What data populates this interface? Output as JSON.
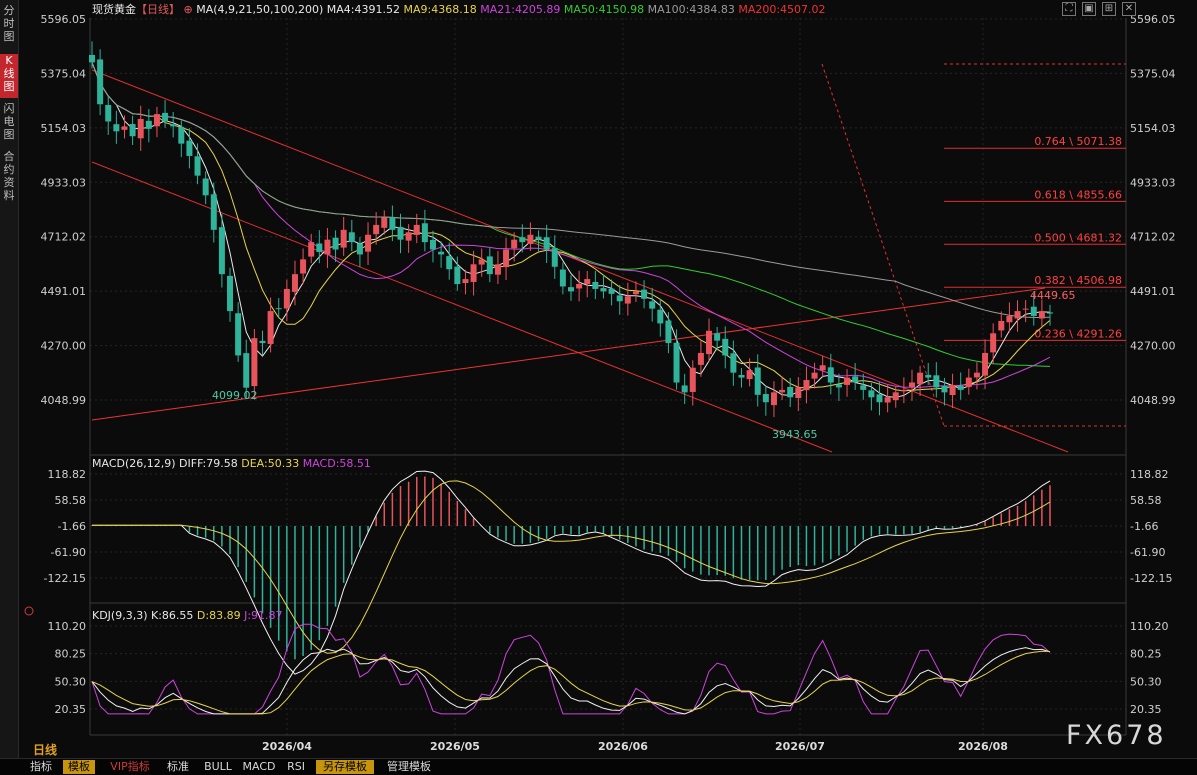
{
  "sidebar": {
    "tabs": [
      {
        "label": "分时图",
        "active": false
      },
      {
        "label": "K线图",
        "active": true
      },
      {
        "label": "闪电图",
        "active": false
      },
      {
        "label": "合约资料",
        "active": false
      }
    ]
  },
  "header": {
    "title": "现货黄金",
    "timeframe": "【日线】",
    "ma_label": "MA(4,9,21,50,100,200)",
    "ma_values": [
      {
        "text": "MA4:4391.52",
        "color": "#e8e8e8"
      },
      {
        "text": "MA9:4368.18",
        "color": "#e8d44a"
      },
      {
        "text": "MA21:4205.89",
        "color": "#cc44dd"
      },
      {
        "text": "MA50:4150.98",
        "color": "#33cc33"
      },
      {
        "text": "MA100:4384.83",
        "color": "#9a9a9a"
      },
      {
        "text": "MA200:4507.02",
        "color": "#ee3333"
      }
    ]
  },
  "price_axis": [
    "5596.05",
    "5375.04",
    "5154.03",
    "4933.03",
    "4712.02",
    "4491.01",
    "4270.00",
    "4048.99"
  ],
  "macd": {
    "label": "MACD(26,12,9)",
    "diff": "DIFF:79.58",
    "dea": "DEA:50.33",
    "macd": "MACD:58.51",
    "axis": [
      "118.82",
      "58.58",
      "-1.66",
      "-61.90",
      "-122.15"
    ]
  },
  "kdj": {
    "label": "KDJ(9,3,3)",
    "k": "K:86.55",
    "d": "D:83.89",
    "j": "J:91.87",
    "axis": [
      "110.20",
      "80.25",
      "50.30",
      "20.35"
    ]
  },
  "x_axis": [
    "2026/04",
    "2026/05",
    "2026/06",
    "2026/07",
    "2026/08"
  ],
  "fib_levels": [
    "0.764 \\ 5071.38",
    "0.618 \\ 4855.66",
    "0.500 \\ 4681.32",
    "0.382 \\ 4506.98",
    "0.236 \\ 4291.26"
  ],
  "price_labels": {
    "low1": "4099.02",
    "low2": "3943.65",
    "high": "4449.65"
  },
  "timeframe_label": "日线",
  "toolbar": [
    "指标",
    "模板",
    "VIP指标",
    "标准",
    "BULL",
    "MACD",
    "RSI",
    "另存模板",
    "管理模板"
  ],
  "watermark": "FX678",
  "colors": {
    "up": "#e8545c",
    "down": "#2fb39a",
    "grid": "#2a2a2a",
    "accent": "#e23a3a"
  },
  "chart_data": {
    "type": "candlestick",
    "title": "现货黄金 【日线】",
    "x_labels": [
      "2026/04",
      "2026/05",
      "2026/06",
      "2026/07",
      "2026/08"
    ],
    "ylim": [
      3943.65,
      5596.05
    ],
    "close_series": [
      5420,
      5250,
      5180,
      5140,
      5160,
      5120,
      5190,
      5150,
      5210,
      5180,
      5160,
      5090,
      5040,
      4960,
      4880,
      4740,
      4560,
      4410,
      4230,
      4099,
      4300,
      4280,
      4410,
      4420,
      4500,
      4560,
      4620,
      4690,
      4650,
      4700,
      4660,
      4740,
      4690,
      4640,
      4720,
      4760,
      4790,
      4740,
      4700,
      4730,
      4760,
      4690,
      4660,
      4640,
      4580,
      4520,
      4540,
      4600,
      4620,
      4560,
      4600,
      4660,
      4700,
      4690,
      4720,
      4700,
      4660,
      4590,
      4510,
      4490,
      4520,
      4540,
      4500,
      4490,
      4480,
      4450,
      4470,
      4490,
      4460,
      4420,
      4360,
      4280,
      4120,
      4080,
      4180,
      4240,
      4330,
      4290,
      4230,
      4160,
      4140,
      4170,
      4070,
      4040,
      4080,
      4090,
      4060,
      4100,
      4130,
      4160,
      4190,
      4120,
      4100,
      4140,
      4120,
      4090,
      4060,
      4040,
      4060,
      4080,
      4090,
      4120,
      4160,
      4140,
      4100,
      4080,
      4110,
      4090,
      4140,
      4160,
      4240,
      4320,
      4370,
      4390,
      4410,
      4420,
      4390,
      4410,
      4400
    ],
    "annotations": {
      "low1": 4099.02,
      "low2": 3943.65,
      "high": 4449.65
    },
    "fibonacci": [
      {
        "ratio": 0.764,
        "price": 5071.38
      },
      {
        "ratio": 0.618,
        "price": 4855.66
      },
      {
        "ratio": 0.5,
        "price": 4681.32
      },
      {
        "ratio": 0.382,
        "price": 4506.98
      },
      {
        "ratio": 0.236,
        "price": 4291.26
      }
    ],
    "ma_last": {
      "MA4": 4391.52,
      "MA9": 4368.18,
      "MA21": 4205.89,
      "MA50": 4150.98,
      "MA100": 4384.83,
      "MA200": 4507.02
    },
    "macd_last": {
      "DIFF": 79.58,
      "DEA": 50.33,
      "MACD": 58.51
    },
    "macd_ylim": [
      -122.15,
      118.82
    ],
    "kdj_last": {
      "K": 86.55,
      "D": 83.89,
      "J": 91.87
    },
    "kdj_ylim": [
      20.35,
      110.2
    ],
    "grid": true
  }
}
